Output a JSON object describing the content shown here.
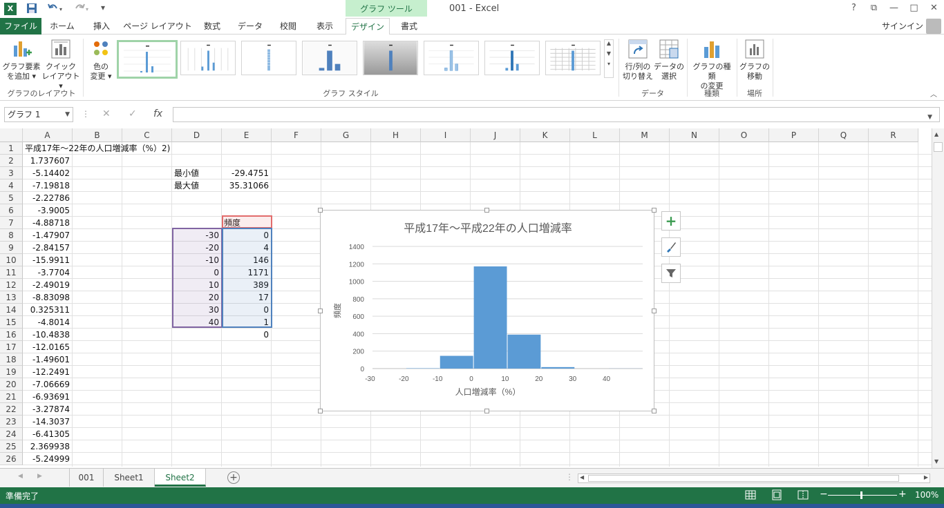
{
  "window": {
    "title": "001 - Excel",
    "context_tab_group": "グラフ ツール",
    "help": "?",
    "restore": "⧉",
    "minimize": "—",
    "maximize": "□",
    "close": "✕"
  },
  "qat": {
    "logo": "X",
    "save_icon": "save-icon",
    "undo_icon": "undo-icon",
    "redo_icon": "redo-icon"
  },
  "tabs": [
    "ファイル",
    "ホーム",
    "挿入",
    "ページ レイアウト",
    "数式",
    "データ",
    "校閲",
    "表示",
    "デザイン",
    "書式"
  ],
  "signin": "サインイン",
  "ribbon": {
    "add_element": "グラフ要素\nを追加 ▾",
    "quick_layout": "クイック\nレイアウト ▾",
    "change_color": "色の\n変更 ▾",
    "switch_rowcol": "行/列の\n切り替え",
    "select_data": "データの\n選択",
    "change_type": "グラフの種類\nの変更",
    "move_chart": "グラフの\n移動",
    "groups": {
      "layout": "グラフのレイアウト",
      "styles": "グラフ スタイル",
      "data": "データ",
      "type": "種類",
      "location": "場所"
    }
  },
  "formula_bar": {
    "name_box": "グラフ 1",
    "cancel": "✕",
    "enter": "✓",
    "fx": "fx",
    "value": ""
  },
  "columns": [
    "A",
    "B",
    "C",
    "D",
    "E",
    "F",
    "G",
    "H",
    "I",
    "J",
    "K",
    "L",
    "M",
    "N",
    "O",
    "P",
    "Q",
    "R"
  ],
  "rows": [
    "1",
    "2",
    "3",
    "4",
    "5",
    "6",
    "7",
    "8",
    "9",
    "10",
    "11",
    "12",
    "13",
    "14",
    "15",
    "16",
    "17",
    "18",
    "19",
    "20",
    "21",
    "22",
    "23",
    "24",
    "25",
    "26"
  ],
  "cells": {
    "A1": "平成17年～22年の人口増減率（%）2)",
    "colA": [
      "",
      "1.737607",
      "-5.14402",
      "-7.19818",
      "-2.22786",
      "-3.9005",
      "-4.88718",
      "-1.47907",
      "-2.84157",
      "-15.9911",
      "-3.7704",
      "-2.49019",
      "-8.83098",
      "0.325311",
      "-4.8014",
      "-10.4838",
      "-12.0165",
      "-1.49601",
      "-12.2491",
      "-7.06669",
      "-6.93691",
      "-3.27874",
      "-14.3037",
      "-6.41305",
      "2.369938",
      "-5.24999"
    ],
    "D3": "最小値",
    "E3": "-29.4751",
    "D4": "最大値",
    "E4": "35.31066",
    "E7": "頻度",
    "colD": [
      "-30",
      "-20",
      "-10",
      "0",
      "10",
      "20",
      "30",
      "40"
    ],
    "colE": [
      "0",
      "4",
      "146",
      "1171",
      "389",
      "17",
      "0",
      "1",
      "0"
    ]
  },
  "chart_data": {
    "type": "bar",
    "title": "平成17年～平成22年の人口増減率",
    "xlabel": "人口増減率（%）",
    "ylabel": "頻度",
    "categories": [
      "-30",
      "-20",
      "-10",
      "0",
      "10",
      "20",
      "30",
      "40"
    ],
    "values": [
      0,
      4,
      146,
      1171,
      389,
      17,
      0,
      1
    ],
    "yticks": [
      "0",
      "200",
      "400",
      "600",
      "800",
      "1000",
      "1200",
      "1400"
    ],
    "ylim": [
      0,
      1400
    ],
    "grid": true,
    "color": "#5b9bd5"
  },
  "chart_side": {
    "add": "+",
    "style": "brush-icon",
    "filter": "filter-icon"
  },
  "sheets": [
    "001",
    "Sheet1",
    "Sheet2"
  ],
  "active_sheet": "Sheet2",
  "add_sheet": "+",
  "status": {
    "ready": "準備完了",
    "zoom": "100%",
    "minus": "−",
    "plus": "+"
  }
}
